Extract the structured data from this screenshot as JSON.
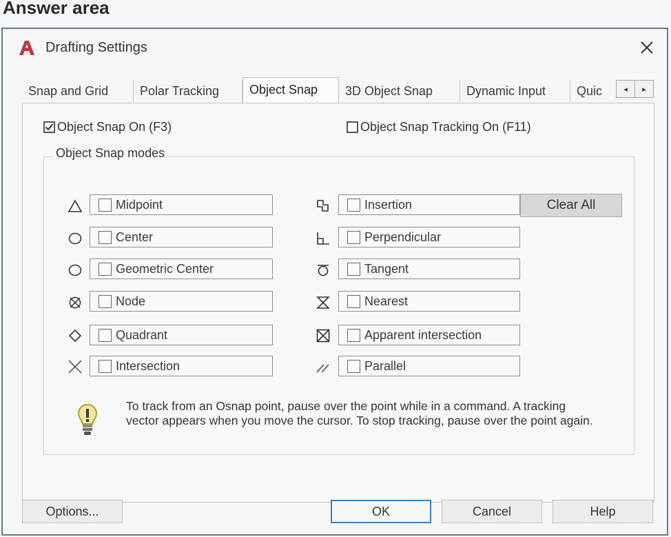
{
  "page": {
    "heading": "Answer area"
  },
  "dialog": {
    "title": "Drafting Settings",
    "app_icon": "autocad-a-icon",
    "close_icon": "close-icon",
    "accent_color": "#3d7fb5",
    "app_icon_color": "#c0363d"
  },
  "tabs": [
    {
      "label": "Snap and Grid",
      "active": false
    },
    {
      "label": "Polar Tracking",
      "active": false
    },
    {
      "label": "Object Snap",
      "active": true
    },
    {
      "label": "3D Object Snap",
      "active": false
    },
    {
      "label": "Dynamic Input",
      "active": false
    },
    {
      "label": "Quic",
      "active": false
    }
  ],
  "tab_scroll": {
    "left": "◂",
    "right": "▸"
  },
  "object_snap": {
    "snap_on": {
      "label": "Object Snap On (F3)",
      "checked": true
    },
    "tracking_on": {
      "label": "Object Snap Tracking On (F11)",
      "checked": false
    },
    "modes_group_label": "Object Snap modes",
    "left_modes": [
      {
        "label": "Midpoint",
        "icon": "midpoint-triangle-icon",
        "checked": false
      },
      {
        "label": "Center",
        "icon": "center-circle-icon",
        "checked": false
      },
      {
        "label": "Geometric Center",
        "icon": "geometric-center-circle-icon",
        "checked": false
      },
      {
        "label": "Node",
        "icon": "node-icon",
        "checked": false
      },
      {
        "label": "Quadrant",
        "icon": "quadrant-diamond-icon",
        "checked": false
      },
      {
        "label": "Intersection",
        "icon": "intersection-x-icon",
        "checked": false
      }
    ],
    "right_modes": [
      {
        "label": "Insertion",
        "icon": "insertion-icon",
        "checked": false
      },
      {
        "label": "Perpendicular",
        "icon": "perpendicular-icon",
        "checked": false
      },
      {
        "label": "Tangent",
        "icon": "tangent-icon",
        "checked": false
      },
      {
        "label": "Nearest",
        "icon": "nearest-hourglass-icon",
        "checked": false
      },
      {
        "label": "Apparent intersection",
        "icon": "apparent-intersection-icon",
        "checked": false
      },
      {
        "label": "Parallel",
        "icon": "parallel-icon",
        "checked": false
      }
    ],
    "clear_all_label": "Clear All",
    "tip_icon": "lightbulb-icon",
    "tip_text": "To track from an Osnap point, pause over the point while in a command.  A tracking vector appears when you move the cursor.  To stop tracking, pause over the point again."
  },
  "footer": {
    "options_label": "Options...",
    "ok_label": "OK",
    "cancel_label": "Cancel",
    "help_label": "Help"
  }
}
